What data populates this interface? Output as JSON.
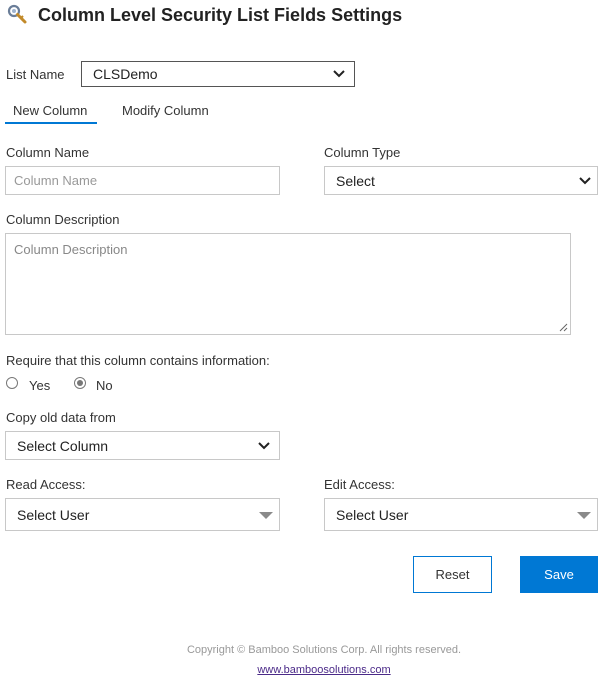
{
  "header": {
    "title": "Column Level Security List Fields Settings",
    "icon": "key-search-icon"
  },
  "list_name": {
    "label": "List Name",
    "value": "CLSDemo"
  },
  "tabs": [
    {
      "label": "New Column",
      "active": true
    },
    {
      "label": "Modify Column",
      "active": false
    }
  ],
  "column_name": {
    "label": "Column Name",
    "placeholder": "Column Name"
  },
  "column_type": {
    "label": "Column Type",
    "value": "Select"
  },
  "column_description": {
    "label": "Column Description",
    "placeholder": "Column Description"
  },
  "require": {
    "label": "Require that this column contains information:",
    "options": [
      {
        "label": "Yes",
        "selected": false
      },
      {
        "label": "No",
        "selected": true
      }
    ]
  },
  "copy_old": {
    "label": "Copy old data from",
    "value": "Select Column"
  },
  "read_access": {
    "label": "Read Access:",
    "value": "Select User"
  },
  "edit_access": {
    "label": "Edit Access:",
    "value": "Select User"
  },
  "buttons": {
    "reset": "Reset",
    "save": "Save"
  },
  "footer": {
    "copyright": "Copyright © Bamboo Solutions Corp. All rights reserved.",
    "link": "www.bamboosolutions.com"
  },
  "colors": {
    "accent": "#0078d4",
    "link": "#4b2a88"
  }
}
